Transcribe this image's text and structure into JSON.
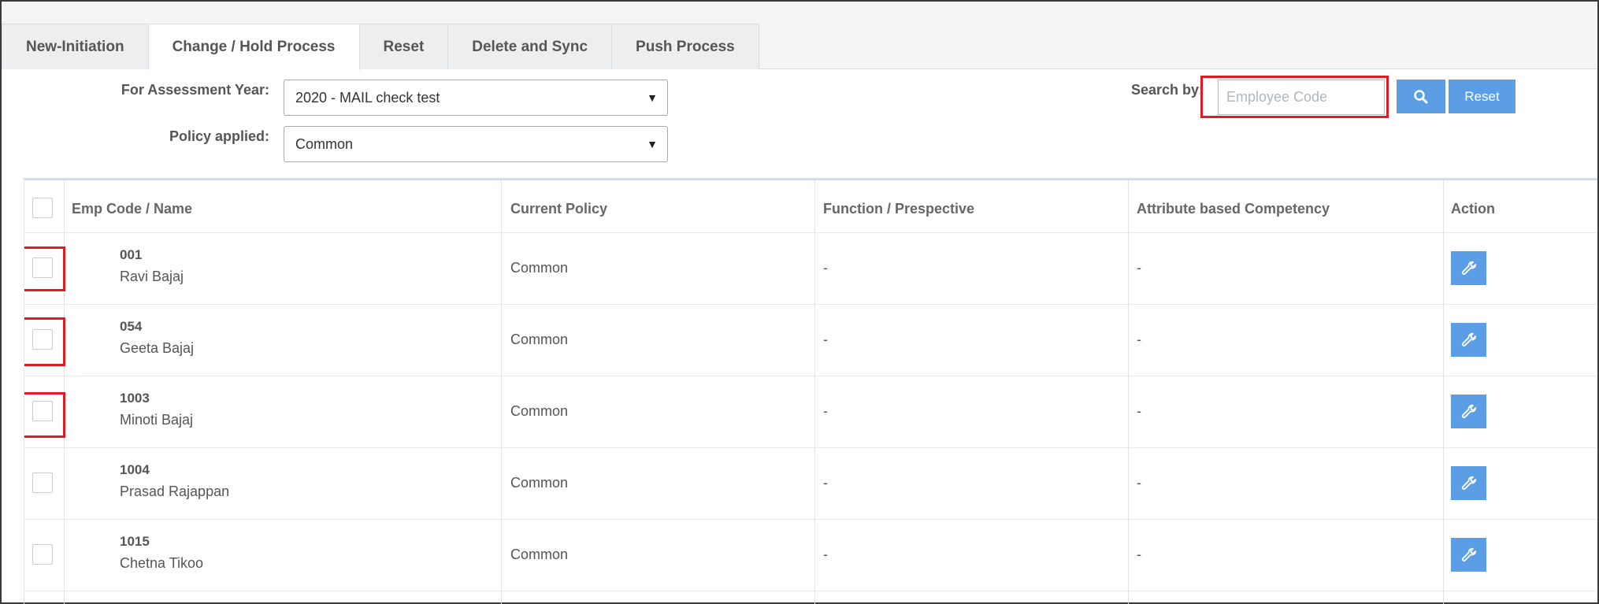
{
  "tabs": [
    {
      "label": "New-Initiation"
    },
    {
      "label": "Change / Hold Process"
    },
    {
      "label": "Reset"
    },
    {
      "label": "Delete and Sync"
    },
    {
      "label": "Push Process"
    }
  ],
  "filters": {
    "assessment_year_label": "For Assessment Year:",
    "assessment_year_value": "2020 - MAIL check test",
    "policy_label": "Policy applied:",
    "policy_value": "Common"
  },
  "search": {
    "label": "Search by:",
    "placeholder": "Employee Code",
    "search_icon": "search-icon",
    "reset_label": "Reset"
  },
  "table": {
    "columns": [
      "Emp Code / Name",
      "Current Policy",
      "Function / Prespective",
      "Attribute based Competency",
      "Action"
    ],
    "rows": [
      {
        "code": "001",
        "name": "Ravi Bajaj",
        "policy": "Common",
        "function": "-",
        "competency": "-"
      },
      {
        "code": "054",
        "name": "Geeta Bajaj",
        "policy": "Common",
        "function": "-",
        "competency": "-"
      },
      {
        "code": "1003",
        "name": "Minoti Bajaj",
        "policy": "Common",
        "function": "-",
        "competency": "-"
      },
      {
        "code": "1004",
        "name": "Prasad Rajappan",
        "policy": "Common",
        "function": "-",
        "competency": "-"
      },
      {
        "code": "1015",
        "name": "Chetna Tikoo",
        "policy": "Common",
        "function": "-",
        "competency": "-"
      }
    ],
    "action_icon": "wrench-icon"
  },
  "colors": {
    "accent": "#5b9ee6",
    "highlight": "#e01b24"
  }
}
